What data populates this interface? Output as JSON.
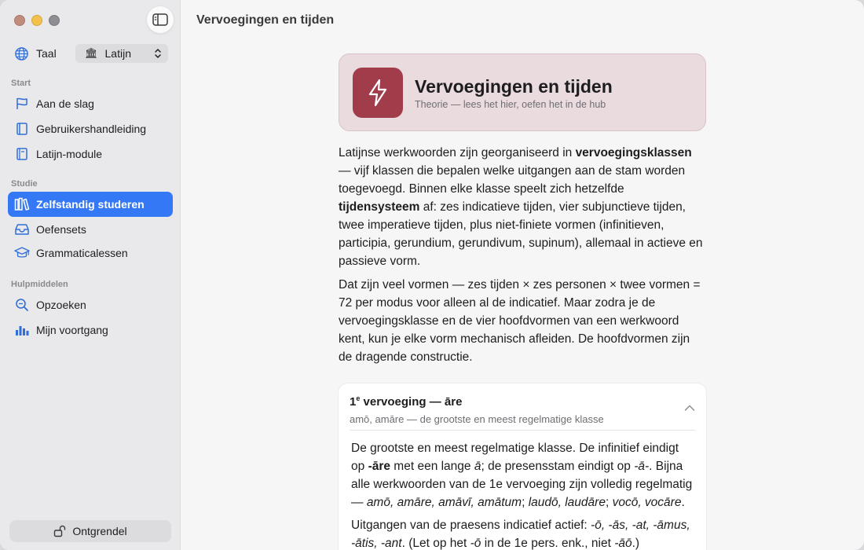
{
  "window": {
    "title": "Vervoegingen en tijden"
  },
  "sidebar": {
    "language": {
      "label": "Taal",
      "value": "Latijn",
      "flag": "🏛"
    },
    "sections": [
      {
        "header": "Start",
        "items": [
          "Aan de slag",
          "Gebruikershandleiding",
          "Latijn-module"
        ]
      },
      {
        "header": "Studie",
        "items": [
          "Zelfstandig studeren",
          "Oefensets",
          "Grammaticalessen"
        ]
      },
      {
        "header": "Hulpmiddelen",
        "items": [
          "Opzoeken",
          "Mijn voortgang"
        ]
      }
    ],
    "active_item": "Zelfstandig studeren",
    "unlock_label": "Ontgrendel"
  },
  "hero": {
    "title": "Vervoegingen en tijden",
    "subtitle": "Theorie — lees het hier, oefen het in de hub",
    "icon": "lightning-icon"
  },
  "intro": {
    "p1_a": "Latijnse werkwoorden zijn georganiseerd in ",
    "p1_b": "vervoegingsklassen",
    "p1_c": " — vijf klassen die bepalen welke uitgangen aan de stam worden toegevoegd. Binnen elke klasse speelt zich hetzelfde ",
    "p1_d": "tijdensysteem",
    "p1_e": " af: zes indicatieve tijden, vier subjunctieve tijden, twee imperatieve tijden, plus niet-finiete vormen (infinitieven, participia, gerundium, gerundivum, supinum), allemaal in actieve en passieve vorm.",
    "p2": "Dat zijn veel vormen — zes tijden × zes personen × twee vormen = 72 per modus voor alleen al de indicatief. Maar zodra je de vervoegingsklasse en de vier hoofdvormen van een werkwoord kent, kun je elke vorm mechanisch afleiden. De hoofdvormen zijn de dragende constructie."
  },
  "card": {
    "title_num": "1",
    "title_sup": "e",
    "title_rest": " vervoeging — āre",
    "subtitle": "amō, amāre — de grootste en meest regelmatige klasse",
    "b1_a": "De grootste en meest regelmatige klasse. De infinitief eindigt op ",
    "b1_b": "-āre",
    "b1_c": " met een lange ",
    "b1_d": "ā",
    "b1_e": "; de presensstam eindigt op ",
    "b1_f": "-ā-",
    "b1_g": ". Bijna alle werkwoorden van de 1e vervoeging zijn volledig regelmatig — ",
    "b1_h": "amō, amāre, amāvī, amātum",
    "b1_i": "; ",
    "b1_j": "laudō, laudāre",
    "b1_k": "; ",
    "b1_l": "vocō, vocāre",
    "b1_m": ".",
    "b2_a": "Uitgangen van de praesens indicatief actief: ",
    "b2_b": "-ō, -ās, -at, -āmus, -ātis, -ant",
    "b2_c": ". (Let op het ",
    "b2_d": "-ō",
    "b2_e": " in de 1e pers. enk., niet ",
    "b2_f": "-āō",
    "b2_g": ".)"
  },
  "colors": {
    "accent": "#3478f6",
    "hero_bg": "#eadbdf",
    "hero_icon": "#a13c4b"
  }
}
